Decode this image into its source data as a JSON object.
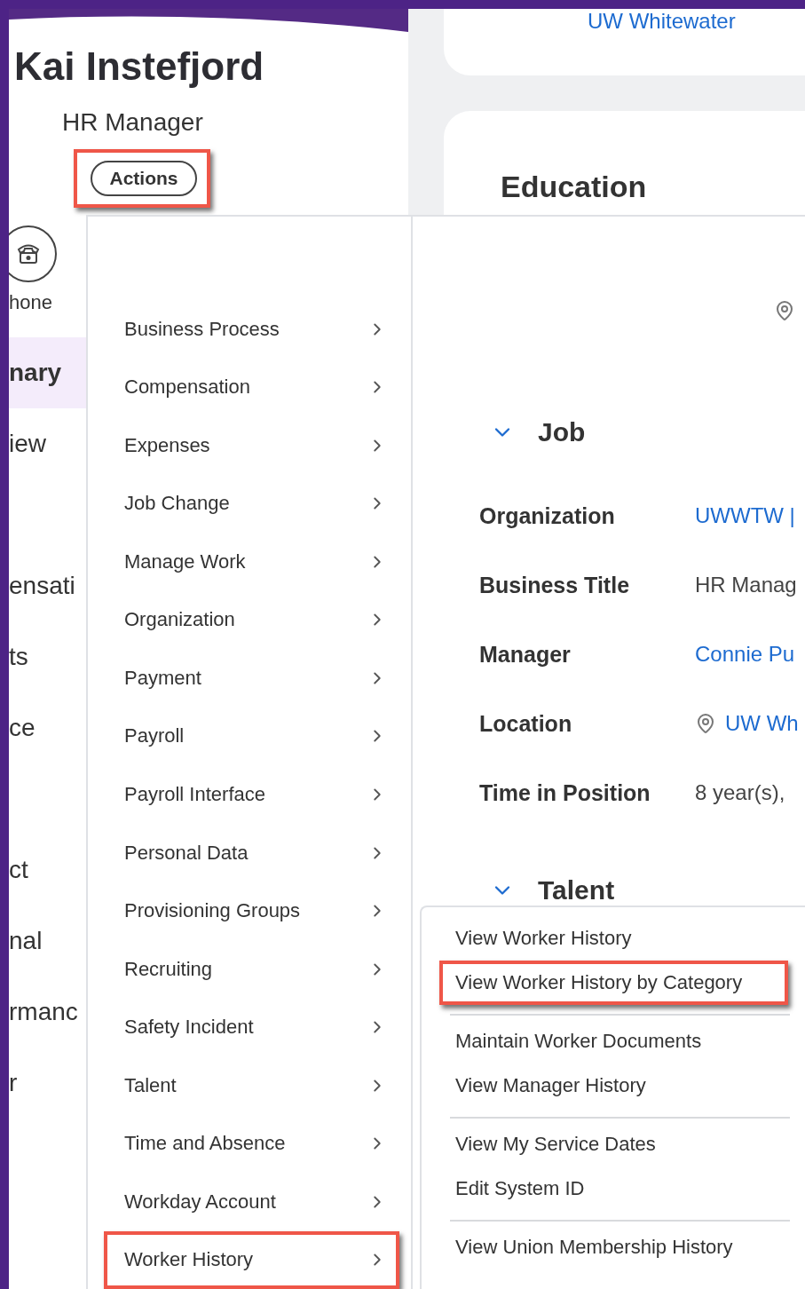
{
  "header": {
    "name": "Kai Instefjord",
    "title": "HR Manager",
    "actions_button": {
      "label": "Actions",
      "highlighted": true
    }
  },
  "side_nav": {
    "phone_label": "hone",
    "groups": [
      [
        {
          "label": "nary",
          "selected": true
        },
        {
          "label": "iew",
          "selected": false
        }
      ],
      [
        {
          "label": "ensati",
          "selected": false
        },
        {
          "label": "ts",
          "selected": false
        },
        {
          "label": "ce",
          "selected": false
        }
      ],
      [
        {
          "label": "ct",
          "selected": false
        },
        {
          "label": "nal",
          "selected": false
        },
        {
          "label": "rmanc",
          "selected": false
        },
        {
          "label": "r",
          "selected": false
        }
      ]
    ]
  },
  "top_card": {
    "link": "UW Whitewater"
  },
  "education": {
    "title": "Education"
  },
  "job": {
    "title": "Job",
    "expanded": true,
    "fields": [
      {
        "label": "Organization",
        "value": "UWWTW |",
        "kind": "link"
      },
      {
        "label": "Business Title",
        "value": "HR Manag",
        "kind": "text"
      },
      {
        "label": "Manager",
        "value": "Connie Pu",
        "kind": "link"
      },
      {
        "label": "Location",
        "value": "UW Wh",
        "kind": "location"
      },
      {
        "label": "Time in Position",
        "value": "8 year(s),",
        "kind": "text"
      }
    ]
  },
  "talent": {
    "title": "Talent",
    "expanded": true
  },
  "actions_menu": {
    "items": [
      {
        "label": "Business Process",
        "highlighted": false
      },
      {
        "label": "Compensation",
        "highlighted": false
      },
      {
        "label": "Expenses",
        "highlighted": false
      },
      {
        "label": "Job Change",
        "highlighted": false
      },
      {
        "label": "Manage Work",
        "highlighted": false
      },
      {
        "label": "Organization",
        "highlighted": false
      },
      {
        "label": "Payment",
        "highlighted": false
      },
      {
        "label": "Payroll",
        "highlighted": false
      },
      {
        "label": "Payroll Interface",
        "highlighted": false
      },
      {
        "label": "Personal Data",
        "highlighted": false
      },
      {
        "label": "Provisioning Groups",
        "highlighted": false
      },
      {
        "label": "Recruiting",
        "highlighted": false
      },
      {
        "label": "Safety Incident",
        "highlighted": false
      },
      {
        "label": "Talent",
        "highlighted": false
      },
      {
        "label": "Time and Absence",
        "highlighted": false
      },
      {
        "label": "Workday Account",
        "highlighted": false
      },
      {
        "label": "Worker History",
        "highlighted": true
      }
    ]
  },
  "submenu": {
    "groups": [
      [
        {
          "label": "View Worker History",
          "highlighted": false
        },
        {
          "label": "View Worker History by Category",
          "highlighted": true
        }
      ],
      [
        {
          "label": "Maintain Worker Documents",
          "highlighted": false
        },
        {
          "label": "View Manager History",
          "highlighted": false
        }
      ],
      [
        {
          "label": "View My Service Dates",
          "highlighted": false
        },
        {
          "label": "Edit System ID",
          "highlighted": false
        }
      ],
      [
        {
          "label": "View Union Membership History",
          "highlighted": false
        }
      ]
    ]
  }
}
